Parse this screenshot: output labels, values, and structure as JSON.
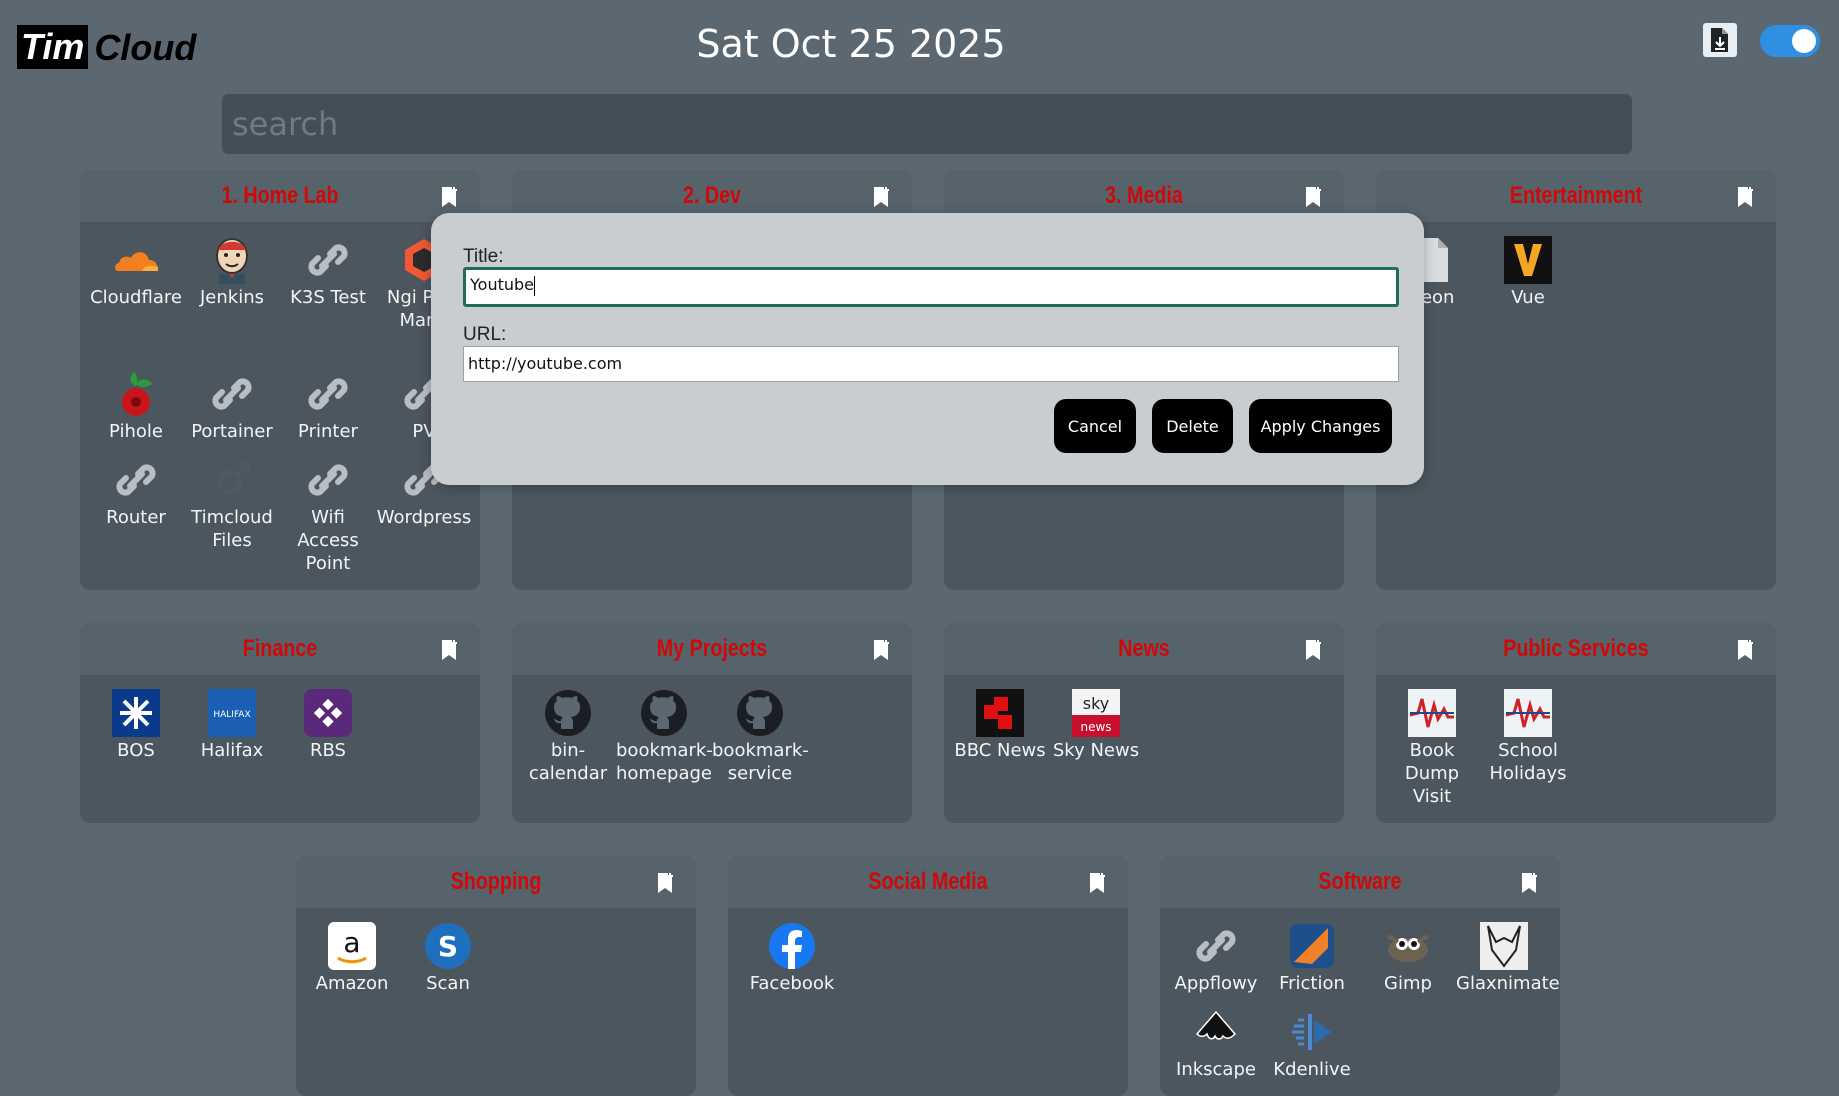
{
  "header": {
    "logo_tim": "Tim",
    "logo_cloud": "Cloud",
    "date": "Sat Oct 25 2025",
    "export_icon": "file-export-icon",
    "toggle_on": true
  },
  "search": {
    "placeholder": "search",
    "value": ""
  },
  "colors": {
    "accent": "#d00808",
    "background": "#5b6872",
    "card": "#4b565e",
    "toggle": "#2f8fe0"
  },
  "cards": {
    "home_lab": {
      "title": "1. Home Lab",
      "items": [
        "Cloudflare",
        "Jenkins",
        "K3S Test",
        "Ngi Prox Mana",
        "Pihole",
        "Portainer",
        "Printer",
        "PV",
        "Router",
        "Timcloud Files",
        "Wifi Access Point",
        "Wordpress"
      ]
    },
    "dev": {
      "title": "2. Dev"
    },
    "media": {
      "title": "3. Media"
    },
    "entertainment": {
      "title": "Entertainment",
      "items": [
        "deon",
        "Vue"
      ]
    },
    "finance": {
      "title": "Finance",
      "items": [
        "BOS",
        "Halifax",
        "RBS"
      ]
    },
    "my_projects": {
      "title": "My Projects",
      "items": [
        "bin-calendar",
        "bookmark-homepage",
        "bookmark-service"
      ]
    },
    "news": {
      "title": "News",
      "items": [
        "BBC News",
        "Sky News"
      ]
    },
    "public_services": {
      "title": "Public Services",
      "items": [
        "Book Dump Visit",
        "School Holidays"
      ]
    },
    "shopping": {
      "title": "Shopping",
      "items": [
        "Amazon",
        "Scan"
      ]
    },
    "social_media": {
      "title": "Social Media",
      "items": [
        "Facebook"
      ]
    },
    "software": {
      "title": "Software",
      "items": [
        "Appflowy",
        "Friction",
        "Gimp",
        "Glaxnimate",
        "Inkscape",
        "Kdenlive"
      ]
    }
  },
  "modal": {
    "title_label": "Title:",
    "title_value": "Youtube",
    "url_label": "URL:",
    "url_value": "http://youtube.com",
    "cancel_label": "Cancel",
    "delete_label": "Delete",
    "apply_label": "Apply Changes"
  }
}
